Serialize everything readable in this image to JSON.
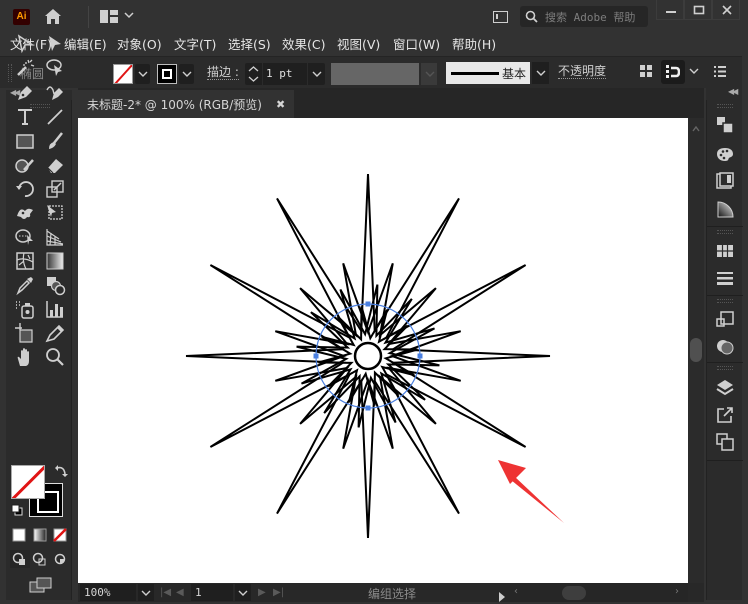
{
  "app": {
    "logo": "Ai",
    "search_placeholder": "搜索 Adobe 帮助",
    "window_controls": [
      "minimize",
      "maximize",
      "close"
    ]
  },
  "menu": [
    {
      "label": "文件(F)"
    },
    {
      "label": "编辑(E)"
    },
    {
      "label": "对象(O)"
    },
    {
      "label": "文字(T)"
    },
    {
      "label": "选择(S)"
    },
    {
      "label": "效果(C)"
    },
    {
      "label": "视图(V)"
    },
    {
      "label": "窗口(W)"
    },
    {
      "label": "帮助(H)"
    }
  ],
  "control_bar": {
    "object_type": "椭圆",
    "fill": "none",
    "stroke_color": "#000000",
    "stroke_label": "描边",
    "stroke_colon": ":",
    "stroke_weight": "1 pt",
    "brush_label": "基本",
    "opacity_label": "不透明度"
  },
  "document": {
    "tab_title": "未标题-2* @ 100% (RGB/预览)",
    "close_glyph": "✖"
  },
  "status_bar": {
    "zoom": "100%",
    "artboard": "1",
    "status_text": "编组选择"
  },
  "tools": [
    {
      "name": "selection-tool"
    },
    {
      "name": "direct-selection-tool"
    },
    {
      "name": "magic-wand-tool"
    },
    {
      "name": "lasso-tool"
    },
    {
      "name": "pen-tool"
    },
    {
      "name": "curvature-tool"
    },
    {
      "name": "type-tool"
    },
    {
      "name": "line-segment-tool"
    },
    {
      "name": "rectangle-tool"
    },
    {
      "name": "paintbrush-tool"
    },
    {
      "name": "shaper-tool"
    },
    {
      "name": "eraser-tool"
    },
    {
      "name": "rotate-tool"
    },
    {
      "name": "scale-tool"
    },
    {
      "name": "puppet-warp-tool"
    },
    {
      "name": "free-transform-tool"
    },
    {
      "name": "shape-builder-tool"
    },
    {
      "name": "perspective-grid-tool"
    },
    {
      "name": "mesh-tool"
    },
    {
      "name": "gradient-tool"
    },
    {
      "name": "eyedropper-tool"
    },
    {
      "name": "blend-tool"
    },
    {
      "name": "symbol-sprayer-tool"
    },
    {
      "name": "column-graph-tool"
    },
    {
      "name": "artboard-tool"
    },
    {
      "name": "slice-tool"
    },
    {
      "name": "hand-tool"
    },
    {
      "name": "zoom-tool"
    }
  ],
  "right_panels": [
    "transform-panel",
    "color-panel",
    "transparency-panel",
    "gradient-panel",
    "swatches-panel",
    "stroke-panel",
    "pathfinder-panel",
    "appearance-panel",
    "layers-panel",
    "export-panel",
    "artboards-panel"
  ],
  "artwork": {
    "stroke_color": "#000000",
    "selection_color": "#4a7fe0",
    "annotation_arrow_color": "#ee3333",
    "outer_star_points": 12,
    "middle_star_points": 12
  }
}
